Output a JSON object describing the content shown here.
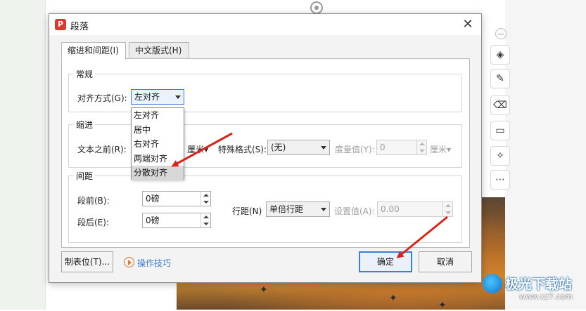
{
  "dialog": {
    "title": "段落",
    "app_icon": "P",
    "close_glyph": "✕"
  },
  "tabs": [
    {
      "label": "缩进和间距(I)",
      "active": true
    },
    {
      "label": "中文版式(H)",
      "active": false
    }
  ],
  "general": {
    "title": "常规",
    "align_label": "对齐方式(G):",
    "align_value": "左对齐",
    "align_options": [
      "左对齐",
      "居中",
      "右对齐",
      "两端对齐",
      "分散对齐"
    ],
    "hovered_option": "分散对齐"
  },
  "indent": {
    "title": "缩进",
    "before_label": "文本之前(R):",
    "before_unit": "厘米",
    "special_label": "特殊格式(S):",
    "special_value": "(无)",
    "measure_label": "度量值(Y):",
    "measure_value": "0",
    "measure_unit": "厘米"
  },
  "spacing": {
    "title": "间距",
    "before_label": "段前(B):",
    "before_value": "0磅",
    "after_label": "段后(E):",
    "after_value": "0磅",
    "line_label": "行距(N)",
    "line_value": "单倍行距",
    "setting_label": "设置值(A):",
    "setting_value": "0.00"
  },
  "footer": {
    "tabs_button": "制表位(T)...",
    "tips_link": "操作技巧",
    "ok_button": "确定",
    "cancel_button": "取消"
  },
  "side_tools": [
    "minus-icon",
    "layers-icon",
    "pen-icon",
    "eraser-icon",
    "laptop-icon",
    "sparkle-icon",
    "more-icon"
  ],
  "watermark": {
    "text": "极光下载站",
    "url": "www.xz7.com"
  },
  "colors": {
    "accent": "#3c7fd6",
    "annotation_arrow": "#d8231b",
    "app_icon": "#d83b2b",
    "tips_link": "#3a7bd5"
  }
}
